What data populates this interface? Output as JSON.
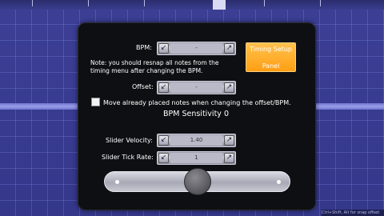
{
  "editor": {
    "bpm_label": "BPM:",
    "bpm_value": "-",
    "note_text_line1": "Note: you should resnap all notes from the",
    "note_text_line2": "timing menu after changing the BPM.",
    "offset_label": "Offset:",
    "offset_value": "-",
    "timing_button_line1": "Timing Setup",
    "timing_button_line2": "Panel",
    "move_notes_label": "Move already placed notes when changing the offset/BPM.",
    "bpm_sensitivity_title": "BPM Sensitivity 0",
    "slider_velocity_label": "Slider Velocity:",
    "slider_velocity_value": "1.40",
    "slider_tick_rate_label": "Slider Tick Rate:",
    "slider_tick_rate_value": "1",
    "move_notes_checked": false,
    "sensitivity_slider_fraction": 0.5,
    "corner_status_text": "Ctrl+Shift, Alt for snap offset"
  },
  "icons": {
    "decrease": "arrow-down-left-icon",
    "increase": "arrow-up-right-icon"
  },
  "colors": {
    "accent": "#ff9f14",
    "panel": "#0e0f12",
    "background": "#3a3d8c"
  }
}
